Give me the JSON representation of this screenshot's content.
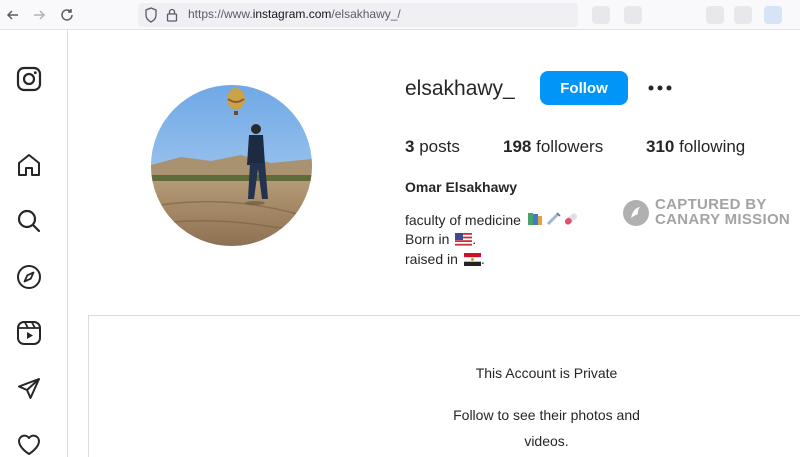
{
  "browser": {
    "url_prefix": "https://www.",
    "url_domain": "instagram.com",
    "url_path": "/elsakhawy_/",
    "back_icon": "arrow-left-icon",
    "forward_icon": "arrow-right-icon",
    "reload_icon": "reload-icon"
  },
  "sidebar": {
    "items": [
      {
        "name": "instagram-logo-icon"
      },
      {
        "name": "home-icon"
      },
      {
        "name": "search-icon"
      },
      {
        "name": "explore-icon"
      },
      {
        "name": "reels-icon"
      },
      {
        "name": "messages-icon"
      },
      {
        "name": "notifications-icon"
      }
    ]
  },
  "profile": {
    "username": "elsakhawy_",
    "follow_label": "Follow",
    "stats": {
      "posts_count": "3",
      "posts_label": "posts",
      "followers_count": "198",
      "followers_label": "followers",
      "following_count": "310",
      "following_label": "following"
    },
    "full_name": "Omar Elsakhawy",
    "bio": {
      "line1": "faculty of medicine",
      "line2": "Born in",
      "line2_end": ".",
      "line3": "raised in",
      "line3_end": "."
    }
  },
  "watermark": {
    "line1": "CAPTURED BY",
    "line2": "CANARY MISSION"
  },
  "private": {
    "title": "This Account is Private",
    "subtitle": "Follow to see their photos and videos."
  },
  "colors": {
    "accent": "#0095f6",
    "border": "#dbdbdb",
    "text": "#262626"
  }
}
